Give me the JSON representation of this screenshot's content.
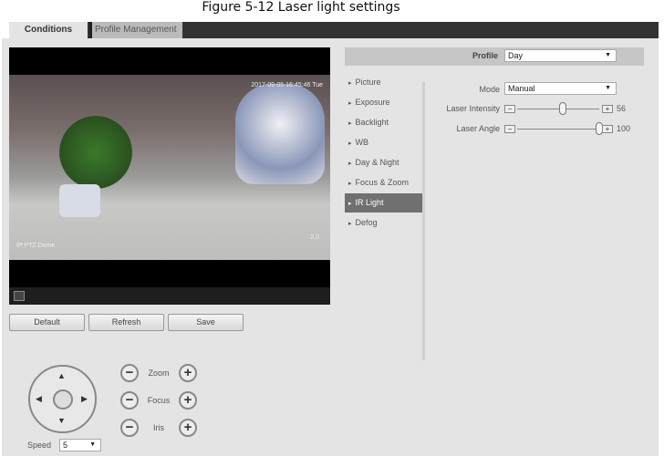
{
  "figure_title": "Figure 5-12 Laser light settings",
  "tabs": [
    {
      "label": "Conditions"
    },
    {
      "label": "Profile Management"
    }
  ],
  "video": {
    "osd_time": "2017-09-05 16:45:46 Tue",
    "osd_name": "IP PTZ Dome",
    "osd_zoom": "2.0",
    "fullscreen_icon": "fullscreen-icon"
  },
  "buttons": {
    "default": "Default",
    "refresh": "Refresh",
    "save": "Save"
  },
  "ptz": {
    "zoom": "Zoom",
    "focus": "Focus",
    "iris": "Iris",
    "minus": "−",
    "plus": "+",
    "speed_label": "Speed",
    "speed_value": "5",
    "up": "▲",
    "down": "▼",
    "left": "◀",
    "right": "▶"
  },
  "profile": {
    "label": "Profile",
    "value": "Day"
  },
  "menu": [
    {
      "label": "Picture"
    },
    {
      "label": "Exposure"
    },
    {
      "label": "Backlight"
    },
    {
      "label": "WB"
    },
    {
      "label": "Day & Night"
    },
    {
      "label": "Focus & Zoom"
    },
    {
      "label": "IR Light",
      "active": true
    },
    {
      "label": "Defog"
    }
  ],
  "settings": {
    "mode": {
      "label": "Mode",
      "value": "Manual"
    },
    "laser_intensity": {
      "label": "Laser Intensity",
      "value": 56,
      "display": "56",
      "min": 0,
      "max": 100
    },
    "laser_angle": {
      "label": "Laser Angle",
      "value": 100,
      "display": "100",
      "min": 0,
      "max": 100
    }
  },
  "caret": "▼",
  "bullet": "▸"
}
